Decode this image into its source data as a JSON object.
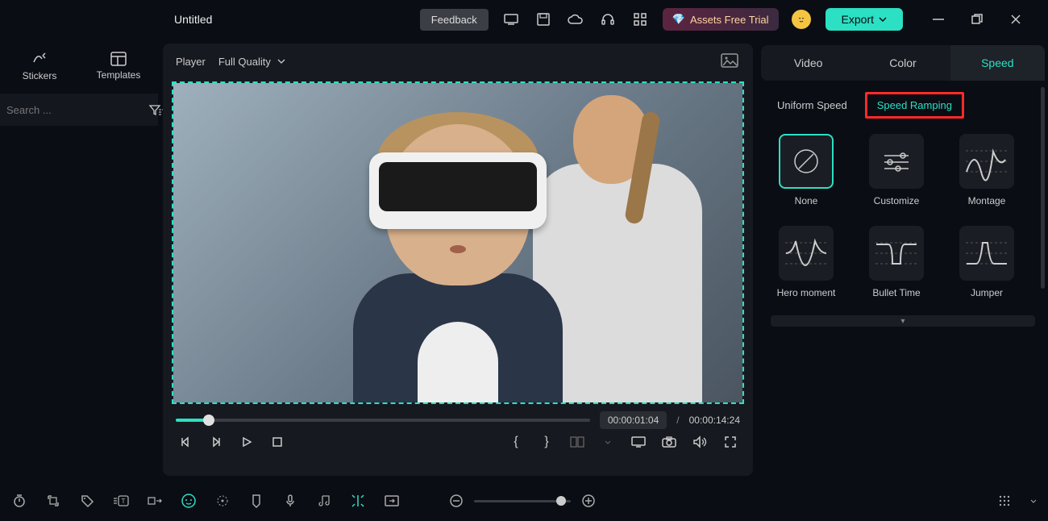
{
  "header": {
    "title": "Untitled",
    "feedback": "Feedback",
    "assets_trial": "Assets Free Trial",
    "export": "Export"
  },
  "sidebar": {
    "tabs": [
      "Stickers",
      "Templates"
    ],
    "search_placeholder": "Search ..."
  },
  "player": {
    "label": "Player",
    "quality": "Full Quality",
    "time_current": "00:00:01:04",
    "time_sep": "/",
    "time_total": "00:00:14:24"
  },
  "panel": {
    "tabs": [
      "Video",
      "Color",
      "Speed"
    ],
    "sub_tabs": [
      "Uniform Speed",
      "Speed Ramping"
    ],
    "presets": [
      {
        "label": "None"
      },
      {
        "label": "Customize"
      },
      {
        "label": "Montage"
      },
      {
        "label": "Hero moment"
      },
      {
        "label": "Bullet Time"
      },
      {
        "label": "Jumper"
      }
    ]
  }
}
